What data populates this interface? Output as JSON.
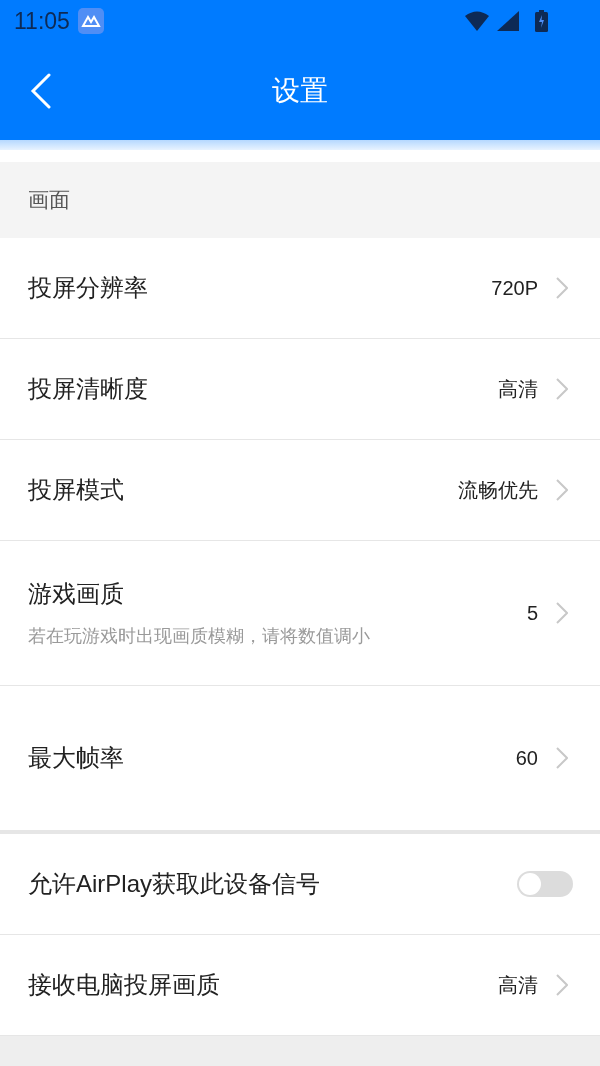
{
  "status_bar": {
    "time": "11:05"
  },
  "header": {
    "title": "设置"
  },
  "sections": [
    {
      "title": "画面",
      "items": [
        {
          "kind": "link",
          "label": "投屏分辨率",
          "value": "720P"
        },
        {
          "kind": "link",
          "label": "投屏清晰度",
          "value": "高清"
        },
        {
          "kind": "link",
          "label": "投屏模式",
          "value": "流畅优先"
        },
        {
          "kind": "link",
          "label": "游戏画质",
          "subtitle": "若在玩游戏时出现画质模糊，请将数值调小",
          "value": "5"
        },
        {
          "kind": "link",
          "label": "最大帧率",
          "value": "60"
        }
      ]
    },
    {
      "items": [
        {
          "kind": "toggle",
          "label": "允许AirPlay获取此设备信号",
          "on": false
        },
        {
          "kind": "link",
          "label": "接收电脑投屏画质",
          "value": "高清"
        }
      ]
    },
    {
      "kind": "band"
    }
  ]
}
